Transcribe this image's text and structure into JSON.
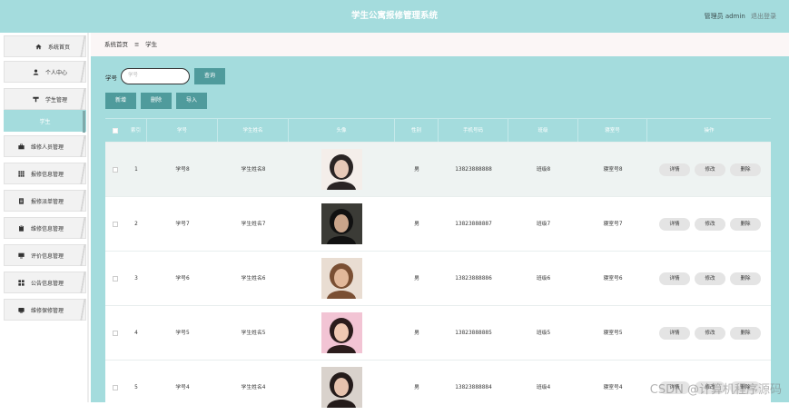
{
  "header": {
    "title": "学生公寓报修管理系统",
    "admin_label": "管理员 admin",
    "logout_label": "退出登录"
  },
  "sidebar": {
    "items": [
      {
        "label": "系统首页",
        "icon": "home-icon"
      },
      {
        "label": "个人中心",
        "icon": "user-icon"
      },
      {
        "label": "学生管理",
        "icon": "funnel-icon"
      },
      {
        "label": "学生",
        "icon": ""
      },
      {
        "label": "维修人员管理",
        "icon": "briefcase-icon"
      },
      {
        "label": "报修信息管理",
        "icon": "grid-icon"
      },
      {
        "label": "报修派单管理",
        "icon": "document-icon"
      },
      {
        "label": "维修信息管理",
        "icon": "clipboard-icon"
      },
      {
        "label": "评价信息管理",
        "icon": "monitor-icon"
      },
      {
        "label": "公告信息管理",
        "icon": "apps-icon"
      },
      {
        "label": "维修保修管理",
        "icon": "card-icon"
      }
    ]
  },
  "breadcrumb": {
    "home": "系统首页",
    "separator": "☰",
    "current": "学生"
  },
  "search": {
    "label": "学号",
    "placeholder": "学号",
    "button": "查询"
  },
  "toolbar": {
    "add": "新增",
    "delete": "删除",
    "import": "导入"
  },
  "table": {
    "headers": [
      "索引",
      "学号",
      "学生姓名",
      "头像",
      "性别",
      "手机号码",
      "班级",
      "寝室号",
      "操作"
    ],
    "actions": {
      "detail": "详情",
      "edit": "修改",
      "delete": "删除"
    },
    "rows": [
      {
        "index": "1",
        "student_id": "学号8",
        "name": "学生姓名8",
        "gender": "男",
        "phone": "13823888888",
        "class": "班级8",
        "dorm": "寝室号8"
      },
      {
        "index": "2",
        "student_id": "学号7",
        "name": "学生姓名7",
        "gender": "男",
        "phone": "13823888887",
        "class": "班级7",
        "dorm": "寝室号7"
      },
      {
        "index": "3",
        "student_id": "学号6",
        "name": "学生姓名6",
        "gender": "男",
        "phone": "13823888886",
        "class": "班级6",
        "dorm": "寝室号6"
      },
      {
        "index": "4",
        "student_id": "学号5",
        "name": "学生姓名5",
        "gender": "男",
        "phone": "13823888885",
        "class": "班级5",
        "dorm": "寝室号5"
      },
      {
        "index": "5",
        "student_id": "学号4",
        "name": "学生姓名4",
        "gender": "男",
        "phone": "13823888884",
        "class": "班级4",
        "dorm": "寝室号4"
      }
    ]
  },
  "watermark": "CSDN @计算机程序源码",
  "colors": {
    "accent": "#a4dcdd",
    "button": "#4f9b9c",
    "active_bar": "#7ea9aa"
  }
}
